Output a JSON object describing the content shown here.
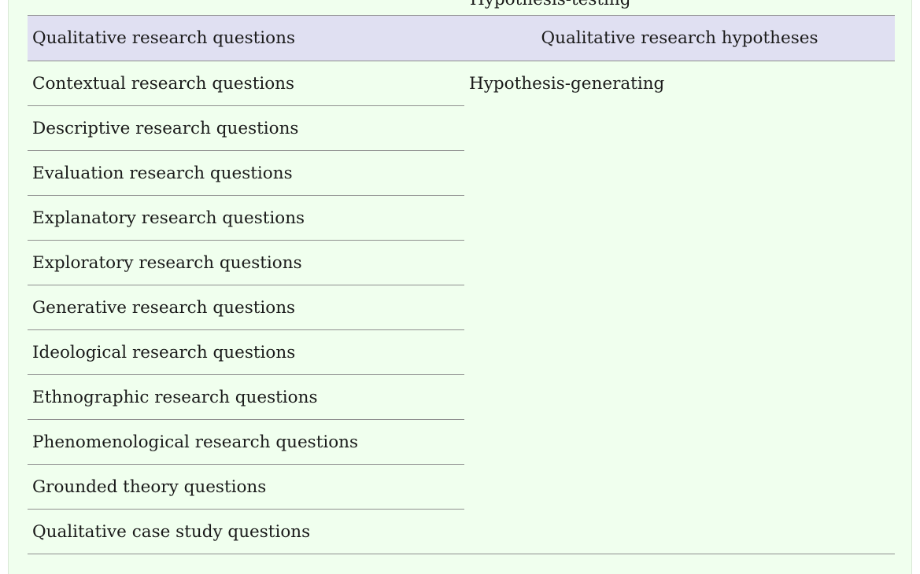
{
  "prev_row": {
    "text": "Hypothesis-testing"
  },
  "table": {
    "headers": {
      "left": "Qualitative research questions",
      "right": "Qualitative research hypotheses"
    },
    "hypothesis": "Hypothesis-generating",
    "questions": [
      "Contextual research questions",
      "Descriptive research questions",
      "Evaluation research questions",
      "Explanatory research questions",
      "Exploratory research questions",
      "Generative research questions",
      "Ideological research questions",
      "Ethnographic research questions",
      "Phenomenological research questions",
      "Grounded theory questions",
      "Qualitative case study questions"
    ]
  },
  "colors": {
    "panel_background": "#f0ffee",
    "header_background": "#e0e0f2",
    "rule": "#8f8f8f"
  }
}
